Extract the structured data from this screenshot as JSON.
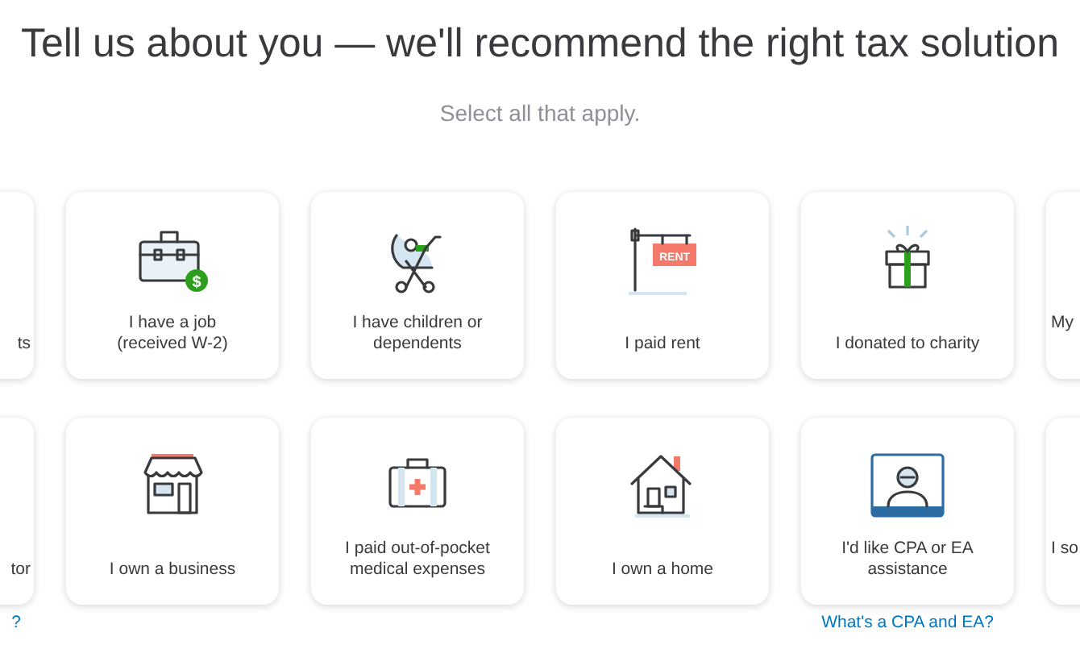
{
  "heading": "Tell us about you — we'll recommend the right tax solution",
  "subheading": "Select all that apply.",
  "rows": [
    {
      "cards": [
        {
          "label": "ts",
          "selected": false
        },
        {
          "label": "I have a job (received W-2)",
          "selected": false,
          "icon_text": "$"
        },
        {
          "label": "I have children or dependents",
          "selected": false
        },
        {
          "label": "I paid rent",
          "selected": false,
          "icon_text": "RENT"
        },
        {
          "label": "I donated to charity",
          "selected": false
        },
        {
          "label": "My",
          "selected": false
        }
      ]
    },
    {
      "cards": [
        {
          "label": "tor",
          "selected": false,
          "link": "?"
        },
        {
          "label": "I own a business",
          "selected": false
        },
        {
          "label": "I paid out-of-pocket medical expenses",
          "selected": false
        },
        {
          "label": "I own a home",
          "selected": false
        },
        {
          "label": "I'd like CPA or EA assistance",
          "selected": false,
          "link": "What's a CPA and EA?"
        },
        {
          "label": "I so",
          "selected": false
        }
      ]
    }
  ]
}
